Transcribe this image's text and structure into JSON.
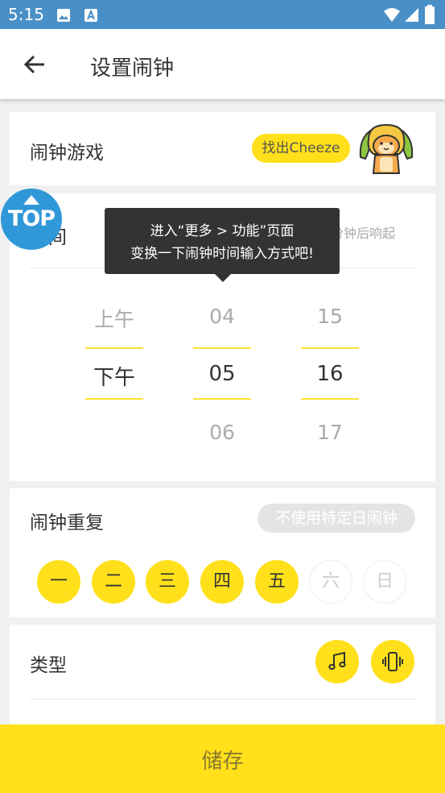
{
  "status_bar": {
    "time": "5:15"
  },
  "header": {
    "title": "设置闹钟"
  },
  "game": {
    "label": "闹钟游戏",
    "button": "找出Cheeze"
  },
  "time": {
    "label": "时间",
    "hint": "闹钟将于1分钟后响起",
    "picker": {
      "ampm": [
        "上午",
        "下午"
      ],
      "hours": [
        "04",
        "05",
        "06"
      ],
      "minutes": [
        "15",
        "16",
        "17"
      ]
    }
  },
  "tooltip": {
    "line1": "进入“更多 > 功能”页面",
    "line2": "变换一下闹钟时间输入方式吧!"
  },
  "top_badge": "TOP",
  "repeat": {
    "label": "闹钟重复",
    "button": "不使用特定日闹钟",
    "days": [
      {
        "label": "一",
        "active": true
      },
      {
        "label": "二",
        "active": true
      },
      {
        "label": "三",
        "active": true
      },
      {
        "label": "四",
        "active": true
      },
      {
        "label": "五",
        "active": true
      },
      {
        "label": "六",
        "active": false
      },
      {
        "label": "日",
        "active": false
      }
    ]
  },
  "type": {
    "label": "类型",
    "icons": [
      "music-note-icon",
      "vibrate-icon"
    ]
  },
  "save": {
    "label": "储存"
  },
  "colors": {
    "accent": "#ffe01a",
    "statusbar": "#4a90c8",
    "badge": "#3098d8"
  }
}
